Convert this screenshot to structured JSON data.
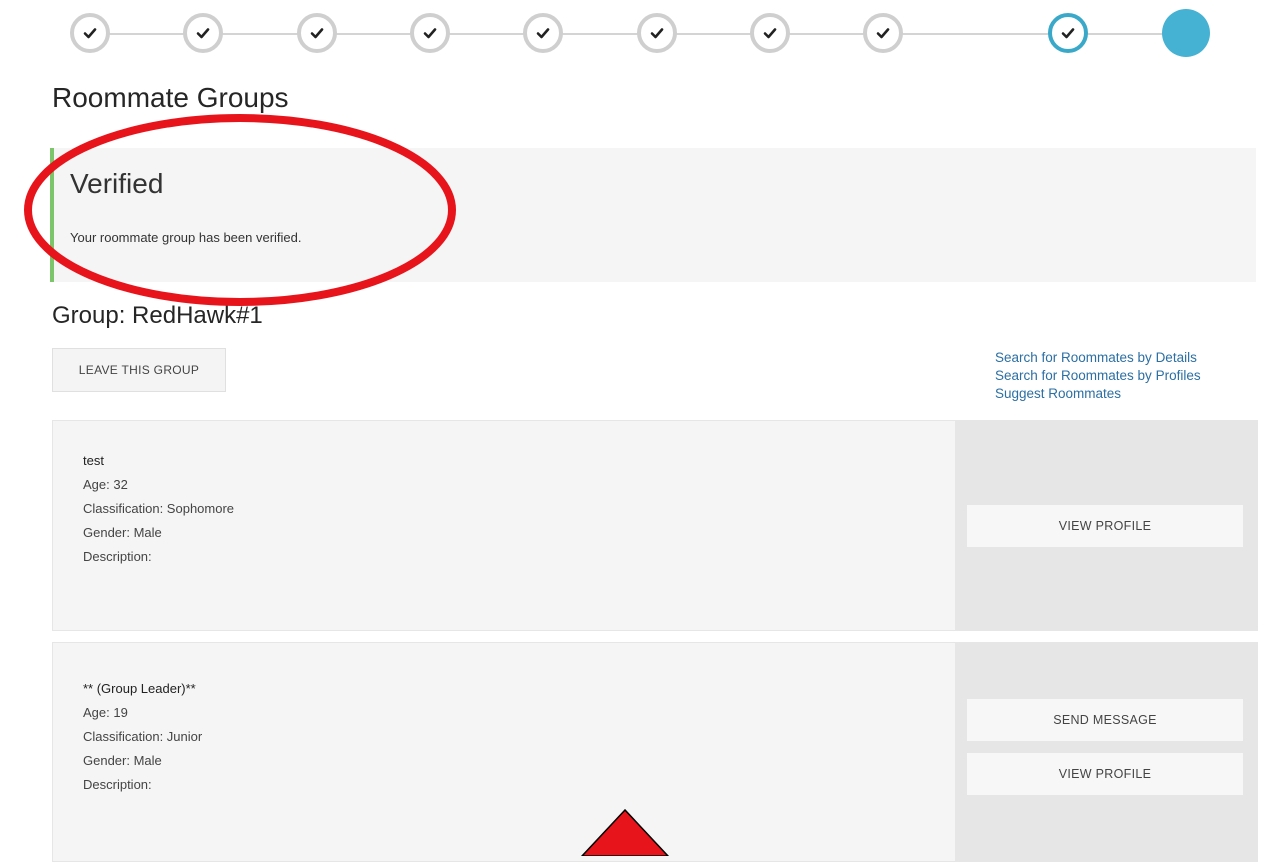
{
  "stepper": {
    "steps": [
      {
        "state": "complete"
      },
      {
        "state": "complete"
      },
      {
        "state": "complete"
      },
      {
        "state": "complete"
      },
      {
        "state": "complete"
      },
      {
        "state": "complete"
      },
      {
        "state": "complete"
      },
      {
        "state": "complete"
      },
      {
        "state": "current"
      },
      {
        "state": "upcoming"
      }
    ]
  },
  "page": {
    "title": "Roommate Groups"
  },
  "alert": {
    "title": "Verified",
    "message": "Your roommate group has been verified."
  },
  "group": {
    "title": "Group: RedHawk#1",
    "leave_label": "LEAVE THIS GROUP"
  },
  "links": {
    "search_details": "Search for Roommates by Details",
    "search_profiles": "Search for Roommates by Profiles",
    "suggest": "Suggest Roommates"
  },
  "members": [
    {
      "name": "test",
      "age": "Age: 32",
      "classification": "Classification: Sophomore",
      "gender": "Gender: Male",
      "description": "Description:",
      "view_profile_label": "VIEW PROFILE"
    },
    {
      "name": "** (Group Leader)**",
      "age": "Age: 19",
      "classification": "Classification: Junior",
      "gender": "Gender: Male",
      "description": "Description:",
      "send_message_label": "SEND MESSAGE",
      "view_profile_label": "VIEW PROFILE"
    }
  ],
  "colors": {
    "accent": "#45b2d3",
    "verified_border": "#7dc56a",
    "link": "#2b6fa3",
    "annotation": "#e8141b"
  },
  "icons": {
    "step_complete": "checkmark-icon"
  }
}
